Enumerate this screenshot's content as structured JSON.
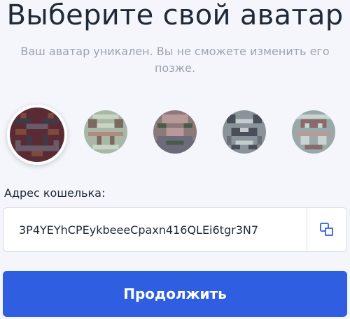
{
  "header": {
    "title": "Выберите свой аватар",
    "subtitle": "Ваш аватар уникален. Вы не сможете изменить его позже."
  },
  "avatars": [
    {
      "name": "avatar-1",
      "selected": true,
      "colors": [
        "#5b2b35",
        "#3f3a44",
        "#7d4a3c",
        "#6a5a6a"
      ]
    },
    {
      "name": "avatar-2",
      "selected": false,
      "colors": [
        "#c9d4c4",
        "#7a6a60",
        "#a8b8a4",
        "#b08a80"
      ]
    },
    {
      "name": "avatar-3",
      "selected": false,
      "colors": [
        "#8a7a7a",
        "#b89898",
        "#4a5a48",
        "#6b6b7b"
      ]
    },
    {
      "name": "avatar-4",
      "selected": false,
      "colors": [
        "#c4ccd0",
        "#4a4e58",
        "#8a929a",
        "#6a707a"
      ]
    },
    {
      "name": "avatar-5",
      "selected": false,
      "colors": [
        "#c8d4d0",
        "#8a6a6a",
        "#b89a9a",
        "#9aa8a8"
      ]
    }
  ],
  "wallet": {
    "label": "Адрес кошелька:",
    "address": "3P4YEYhCPEykbeeeCpaxn416QLEi6tgr3N7",
    "copy_icon": "copy-icon"
  },
  "actions": {
    "continue_label": "Продолжить",
    "accent_color": "#2f5fe0"
  }
}
